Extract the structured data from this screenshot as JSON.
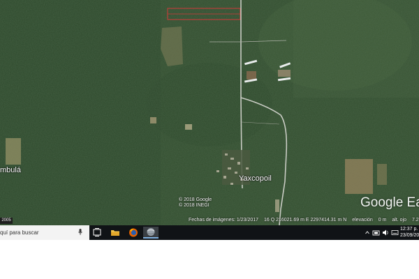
{
  "map": {
    "place_labels": [
      "mbulá",
      "Yaxcopoil"
    ],
    "copyright": [
      "© 2018 Google",
      "© 2018 INEGI"
    ],
    "logo": "Google Ea",
    "year_badge": "2005",
    "status": {
      "imagery_date": "Fechas de imágenes: 1/23/2017",
      "coordinates": "16 Q 216021.69 m E 2297414.31 m N",
      "elevation": "elevación",
      "elevation_value": "0 m",
      "eye_alt": "alt. ojo",
      "eye_alt_value": "7.2"
    },
    "colors": {
      "forest": "#2f4a2c",
      "clearing": "#8a8a60",
      "road": "#c9ccc4",
      "highlight": "#d23a3a"
    }
  },
  "taskbar": {
    "search_text": "quí para buscar",
    "mic_icon": "microphone-icon",
    "apps": [
      "task-view-icon",
      "file-explorer-icon",
      "firefox-icon",
      "google-earth-icon"
    ],
    "tray_icons": [
      "chevron-up-icon",
      "network-icon",
      "volume-icon",
      "keyboard-icon"
    ],
    "clock_time": "12:37 p. m.",
    "clock_date": "23/09/201"
  }
}
